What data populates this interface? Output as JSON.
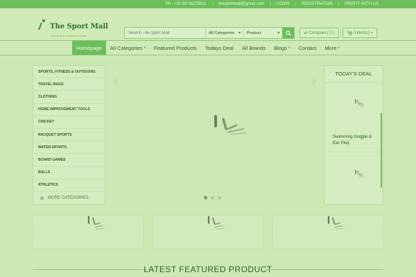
{
  "topbar": {
    "phone": "Ph : +91 80 38275511",
    "email": "thesportmall@gmail.com",
    "login": "LOGIN",
    "register": "REGISTRATION",
    "profit": "PROFIT WITH US"
  },
  "logo": {
    "name": "The Sport Mall",
    "tagline": "SPORTS & FITNESS STORE",
    "icon": "runner-icon"
  },
  "search": {
    "placeholder": "Search The Sport Mall",
    "category": "All Categories",
    "type": "Product",
    "icon": "search-icon"
  },
  "header": {
    "compare": "Compare ( 0 )",
    "cart": "0 item(s)",
    "compare_icon": "swap-icon",
    "cart_icon": "cart-icon"
  },
  "nav": {
    "items": [
      {
        "label": "Homepage",
        "active": true,
        "caret": false
      },
      {
        "label": "All Categories",
        "active": false,
        "caret": true
      },
      {
        "label": "Featured Products",
        "active": false,
        "caret": false
      },
      {
        "label": "Todays Deal",
        "active": false,
        "caret": false
      },
      {
        "label": "All Brands",
        "active": false,
        "caret": false
      },
      {
        "label": "Blogs",
        "active": false,
        "caret": true
      },
      {
        "label": "Contact",
        "active": false,
        "caret": false
      },
      {
        "label": "More",
        "active": false,
        "caret": true
      }
    ]
  },
  "sidebar": {
    "categories": [
      "SPORTS, FITNESS & OUTDOORS",
      "TRAVEL BAGS",
      "CLOTHING",
      "HOME IMPROVEMENT TOOLS",
      "CRICKET",
      "RACQUET SPORTS",
      "WATER SPORTS",
      "BOARD GAMES",
      "BALLS",
      "ATHLETICS"
    ],
    "more": "MORE CATEGORIES"
  },
  "deal": {
    "title": "TODAY'S DEAL",
    "product": "Swimming Goggle & Ear Plug"
  },
  "section": {
    "featured_title": "LATEST FEATURED PRODUCT"
  },
  "colors": {
    "accent": "#6cbe5a",
    "background": "#cde9b3",
    "text": "#2f5d22"
  }
}
